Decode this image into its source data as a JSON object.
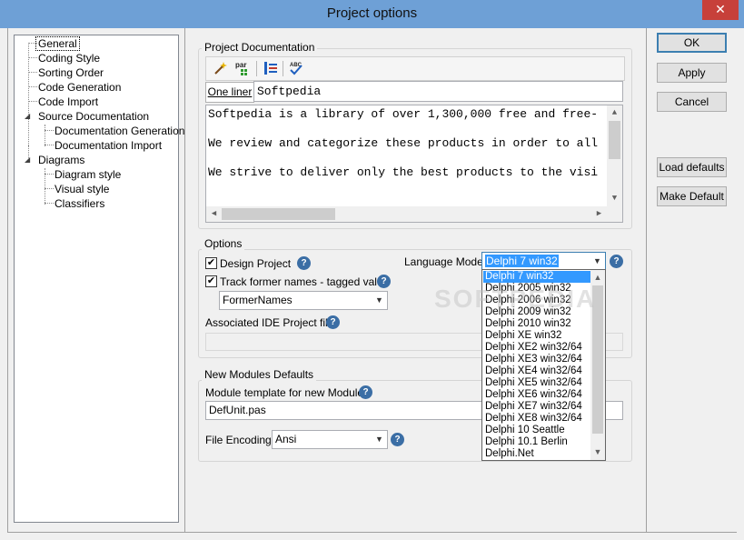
{
  "window": {
    "title": "Project options",
    "close_glyph": "✕"
  },
  "tree": {
    "items": [
      {
        "label": "General",
        "selected": true
      },
      {
        "label": "Coding Style"
      },
      {
        "label": "Sorting Order"
      },
      {
        "label": "Code Generation"
      },
      {
        "label": "Code Import"
      },
      {
        "label": "Source Documentation",
        "expanded": true
      },
      {
        "label": "Documentation Generation"
      },
      {
        "label": "Documentation Import"
      },
      {
        "label": "Diagrams",
        "expanded": true
      },
      {
        "label": "Diagram style"
      },
      {
        "label": "Visual style"
      },
      {
        "label": "Classifiers"
      }
    ]
  },
  "project_doc": {
    "title": "Project Documentation",
    "toolbar": {
      "wand_icon": "magic-wand-icon",
      "par_icon": "add-paragraph-icon",
      "list_icon": "list-icon",
      "spell_icon": "spellcheck-icon"
    },
    "one_liner_label": "One liner",
    "one_liner_value": "Softpedia",
    "memo_lines": [
      "Softpedia is a library of over 1,300,000 free and free-",
      "We review and categorize these products in order to all",
      "We strive to deliver only the best products to the visi"
    ]
  },
  "options": {
    "title": "Options",
    "design_project": {
      "label": "Design Project",
      "checked": true
    },
    "track_former": {
      "label": "Track former names - tagged value",
      "checked": true
    },
    "former_names_value": "FormerNames",
    "associated_label": "Associated IDE Project file",
    "language_mode_label": "Language Mode",
    "language_mode_value": "Delphi 7 win32",
    "language_options": [
      "Delphi 7 win32",
      "Delphi 2005 win32",
      "Delphi 2006 win32",
      "Delphi 2009 win32",
      "Delphi 2010 win32",
      "Delphi XE win32",
      "Delphi XE2 win32/64",
      "Delphi XE3 win32/64",
      "Delphi XE4 win32/64",
      "Delphi XE5 win32/64",
      "Delphi XE6 win32/64",
      "Delphi XE7 win32/64",
      "Delphi XE8 win32/64",
      "Delphi 10 Seattle",
      "Delphi 10.1 Berlin",
      "Delphi.Net"
    ],
    "selected_index": 0
  },
  "new_modules": {
    "title": "New Modules Defaults",
    "template_label": "Module template for new Modules",
    "template_value": "DefUnit.pas",
    "encoding_label": "File Encoding",
    "encoding_value": "Ansi"
  },
  "buttons": {
    "ok": "OK",
    "apply": "Apply",
    "cancel": "Cancel",
    "load_defaults": "Load defaults",
    "make_default": "Make Default"
  },
  "help_glyph": "?",
  "check_glyph": "✔",
  "watermark": "SOFTPEDIA"
}
